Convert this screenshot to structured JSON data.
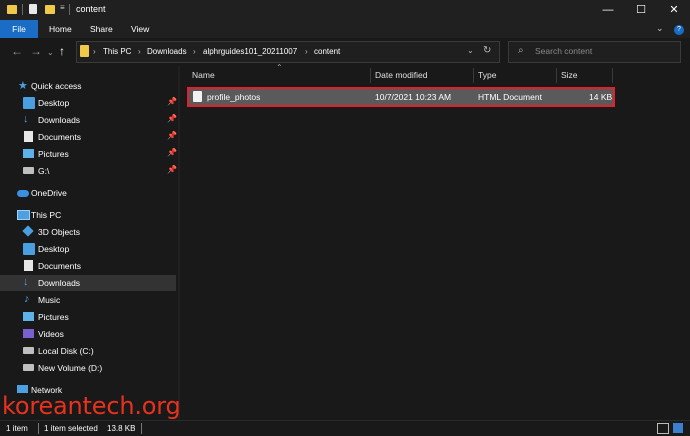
{
  "window": {
    "title": "content",
    "controls": {
      "minimize": "—",
      "maximize": "☐",
      "close": "✕"
    }
  },
  "ribbon": {
    "tabs": [
      "File",
      "Home",
      "Share",
      "View"
    ]
  },
  "address": {
    "breadcrumbs": [
      "This PC",
      "Downloads",
      "alphrguides101_20211007",
      "content"
    ],
    "search_placeholder": "Search content"
  },
  "nav": {
    "quick_access": "Quick access",
    "quick_items": [
      {
        "label": "Desktop",
        "pinned": true
      },
      {
        "label": "Downloads",
        "pinned": true
      },
      {
        "label": "Documents",
        "pinned": true
      },
      {
        "label": "Pictures",
        "pinned": true
      },
      {
        "label": "G:\\",
        "pinned": true
      }
    ],
    "onedrive": "OneDrive",
    "this_pc": "This PC",
    "pc_items": [
      "3D Objects",
      "Desktop",
      "Documents",
      "Downloads",
      "Music",
      "Pictures",
      "Videos",
      "Local Disk (C:)",
      "New Volume (D:)"
    ],
    "selected": "Downloads",
    "network": "Network"
  },
  "columns": [
    "Name",
    "Date modified",
    "Type",
    "Size"
  ],
  "files": [
    {
      "name": "profile_photos",
      "date": "10/7/2021 10:23 AM",
      "type": "HTML Document",
      "size": "14 KB"
    }
  ],
  "status": {
    "count": "1 item",
    "selected": "1 item selected",
    "size": "13.8 KB"
  },
  "watermark": "koreantech.org",
  "colors": {
    "accent": "#1a6cc4",
    "highlight_border": "#e0202a",
    "folder": "#f0c84a"
  }
}
